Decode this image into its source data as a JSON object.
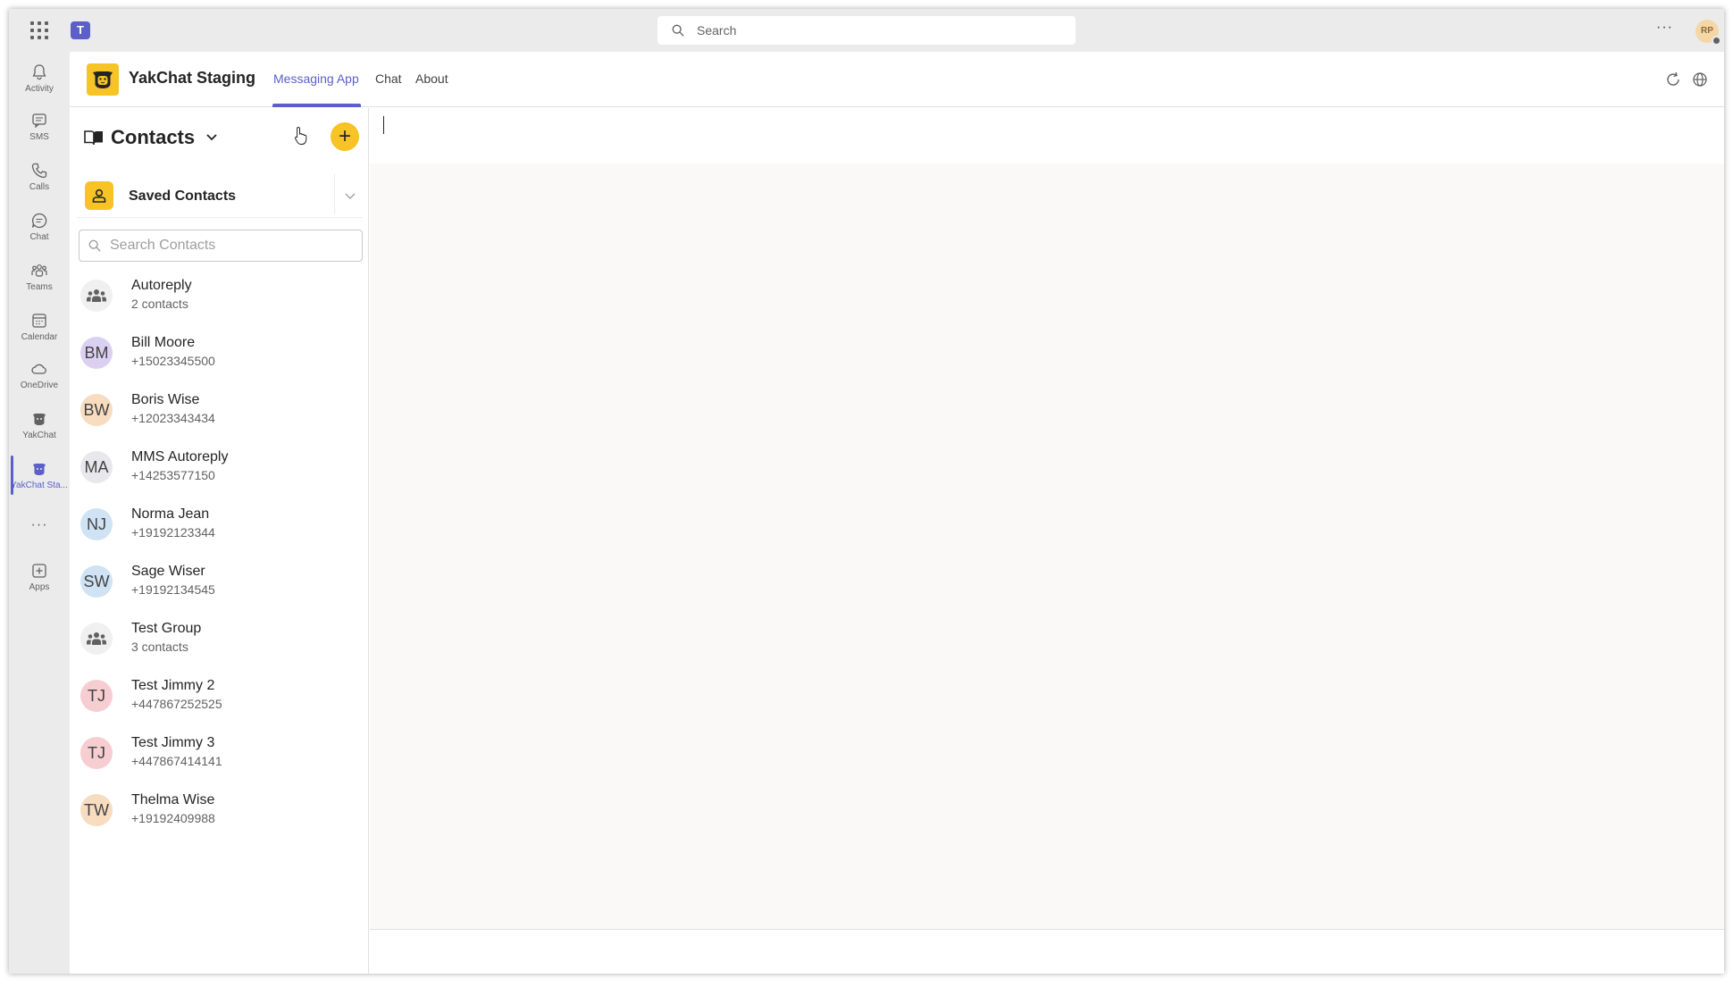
{
  "topbar": {
    "search_placeholder": "Search",
    "more_label": "···",
    "avatar_initials": "RP"
  },
  "rail": {
    "items": [
      {
        "label": "Activity",
        "icon": "bell-icon"
      },
      {
        "label": "SMS",
        "icon": "message-icon"
      },
      {
        "label": "Calls",
        "icon": "phone-icon"
      },
      {
        "label": "Chat",
        "icon": "chat-icon"
      },
      {
        "label": "Teams",
        "icon": "teams-icon"
      },
      {
        "label": "Calendar",
        "icon": "calendar-icon"
      },
      {
        "label": "OneDrive",
        "icon": "cloud-icon"
      },
      {
        "label": "YakChat",
        "icon": "yak-icon"
      },
      {
        "label": "YakChat Sta...",
        "icon": "yak-icon"
      },
      {
        "label": "",
        "icon": "more-icon"
      },
      {
        "label": "Apps",
        "icon": "add-app-icon"
      }
    ],
    "more_label": "···"
  },
  "app": {
    "title": "YakChat Staging",
    "tabs": [
      {
        "label": "Messaging App",
        "active": true
      },
      {
        "label": "Chat",
        "active": false
      },
      {
        "label": "About",
        "active": false
      }
    ]
  },
  "contacts": {
    "title": "Contacts",
    "add_label": "+",
    "saved_label": "Saved Contacts",
    "search_placeholder": "Search Contacts",
    "items": [
      {
        "name": "Autoreply",
        "sub": "2 contacts",
        "initials": "",
        "group": true,
        "color": "#f0f0f0"
      },
      {
        "name": "Bill Moore",
        "sub": "+15023345500",
        "initials": "BM",
        "group": false,
        "color": "#dcd0f2"
      },
      {
        "name": "Boris Wise",
        "sub": "+12023343434",
        "initials": "BW",
        "group": false,
        "color": "#f7dcc0"
      },
      {
        "name": "MMS Autoreply",
        "sub": "+14253577150",
        "initials": "MA",
        "group": false,
        "color": "#e8e8ec"
      },
      {
        "name": "Norma Jean",
        "sub": "+19192123344",
        "initials": "NJ",
        "group": false,
        "color": "#cfe3f5"
      },
      {
        "name": "Sage Wiser",
        "sub": "+19192134545",
        "initials": "SW",
        "group": false,
        "color": "#cfe3f5"
      },
      {
        "name": "Test Group",
        "sub": "3 contacts",
        "initials": "",
        "group": true,
        "color": "#f0f0f0"
      },
      {
        "name": "Test Jimmy 2",
        "sub": "+447867252525",
        "initials": "TJ",
        "group": false,
        "color": "#f6cdd0"
      },
      {
        "name": "Test Jimmy 3",
        "sub": "+447867414141",
        "initials": "TJ",
        "group": false,
        "color": "#f6cdd0"
      },
      {
        "name": "Thelma Wise",
        "sub": "+19192409988",
        "initials": "TW",
        "group": false,
        "color": "#f7dcc0"
      }
    ]
  },
  "colors": {
    "accent": "#5b5fc7",
    "brand_yellow": "#f7c325"
  }
}
